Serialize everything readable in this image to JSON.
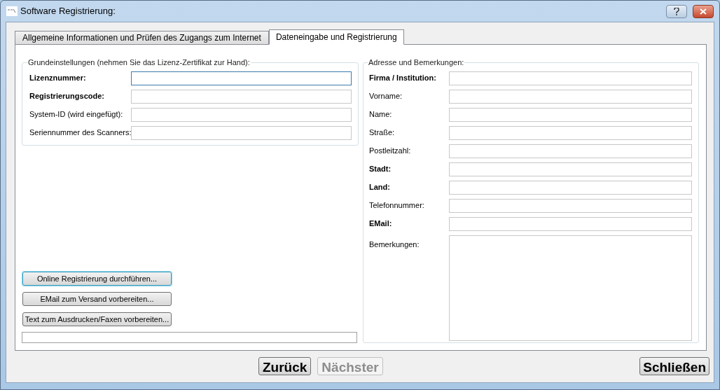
{
  "window": {
    "title": "Software Registrierung:"
  },
  "tabs": [
    {
      "label": "Allgemeine Informationen und Prüfen des Zugangs zum Internet",
      "selected": false
    },
    {
      "label": "Dateneingabe und Registrierung",
      "selected": true
    }
  ],
  "basic_settings": {
    "title": "Grundeinstellungen (nehmen Sie das Lizenz-Zertifikat zur Hand):",
    "fields": [
      {
        "label": "Lizenznummer:",
        "bold": true,
        "focused": true
      },
      {
        "label": "Registrierungscode:",
        "bold": true,
        "focused": false
      },
      {
        "label": "System-ID (wird eingefügt):",
        "bold": false,
        "focused": false
      },
      {
        "label": "Seriennummer des Scanners:",
        "bold": false,
        "focused": false
      }
    ]
  },
  "actions": [
    {
      "label": "Online Registrierung durchführen...",
      "focused": true
    },
    {
      "label": "EMail zum Versand vorbereiten...",
      "focused": false
    },
    {
      "label": "Text zum Ausdrucken/Faxen vorbereiten...",
      "focused": false
    }
  ],
  "address": {
    "title": "Adresse und Bemerkungen:",
    "fields": [
      {
        "label": "Firma / Institution:",
        "bold": true,
        "kind": "line"
      },
      {
        "label": "Vorname:",
        "bold": false,
        "kind": "line"
      },
      {
        "label": "Name:",
        "bold": false,
        "kind": "line"
      },
      {
        "label": "Straße:",
        "bold": false,
        "kind": "line"
      },
      {
        "label": "Postleitzahl:",
        "bold": false,
        "kind": "line"
      },
      {
        "label": "Stadt:",
        "bold": true,
        "kind": "line"
      },
      {
        "label": "Land:",
        "bold": true,
        "kind": "line"
      },
      {
        "label": "Telefonnummer:",
        "bold": false,
        "kind": "line"
      },
      {
        "label": "EMail:",
        "bold": true,
        "kind": "line"
      },
      {
        "label": "Bemerkungen:",
        "bold": false,
        "kind": "multiline"
      }
    ]
  },
  "footer_buttons": [
    {
      "label": "Zurück",
      "disabled": false
    },
    {
      "label": "Nächster",
      "disabled": true
    }
  ],
  "close_button": {
    "label": "Schließen"
  }
}
